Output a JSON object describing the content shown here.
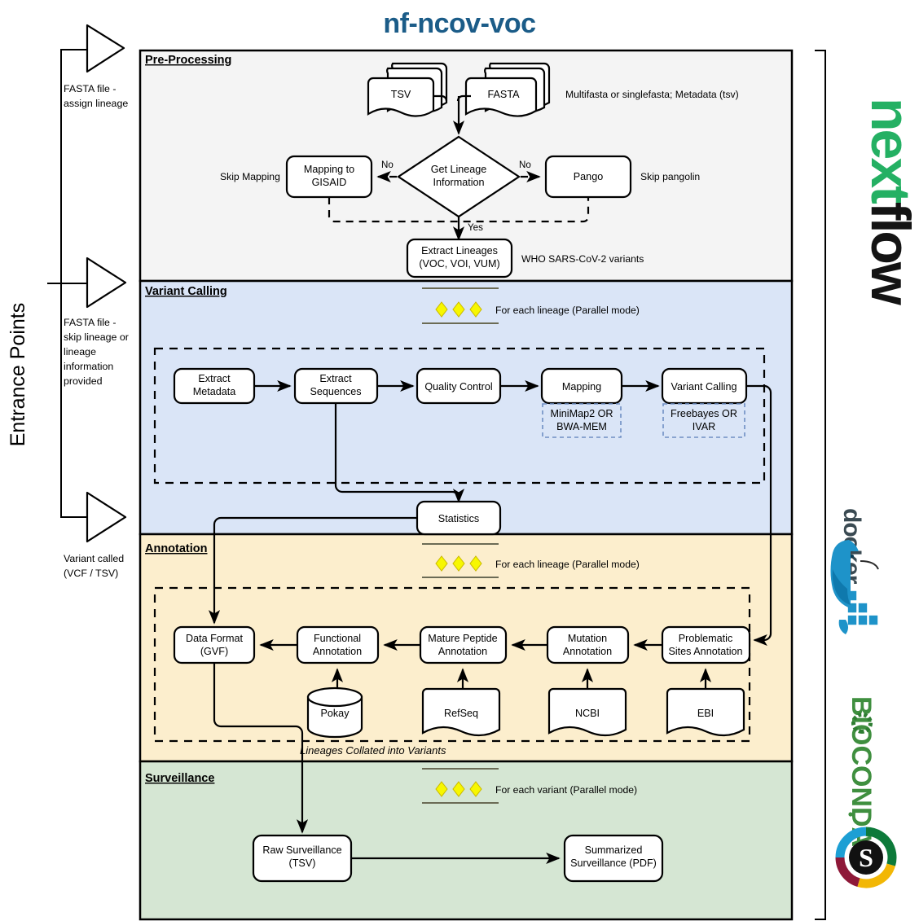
{
  "title": "nf-ncov-voc",
  "colors": {
    "title": "#1b5c88",
    "preprocessing_bg": "#f4f4f4",
    "variant_calling_bg": "#dae5f7",
    "annotation_bg": "#fceecd",
    "surveillance_bg": "#d5e6d3",
    "parallel_diamond": "#f7f700",
    "nextflow_green": "#22b06a",
    "docker_blue": "#2496ed",
    "bioconda_green": "#3f8f3f"
  },
  "entrance": {
    "axis_label": "Entrance Points",
    "points": [
      {
        "label": "FASTA file -\nassign lineage",
        "line1": "FASTA file -",
        "line2": "assign lineage"
      },
      {
        "label": "FASTA file - skip lineage or lineage information provided",
        "line1": "FASTA file -",
        "line2": "skip lineage or",
        "line3": "lineage",
        "line4": "information",
        "line5": "provided"
      },
      {
        "label": "Variant called (VCF / TSV)",
        "line1": "Variant called",
        "line2": "(VCF / TSV)"
      }
    ]
  },
  "sections": [
    {
      "id": "pre-processing",
      "title": "Pre-Processing",
      "nodes": [
        {
          "name": "tsv-document",
          "label": "TSV",
          "shape": "multi-document"
        },
        {
          "name": "fasta-document",
          "label": "FASTA",
          "shape": "multi-document"
        },
        {
          "name": "get-lineage-information",
          "label": "Get Lineage\nInformation",
          "line1": "Get Lineage",
          "line2": "Information",
          "shape": "diamond"
        },
        {
          "name": "mapping-to-gisaid",
          "label": "Mapping to\nGISAID",
          "line1": "Mapping to",
          "line2": "GISAID",
          "shape": "rounded-box"
        },
        {
          "name": "pango",
          "label": "Pango",
          "shape": "rounded-box"
        },
        {
          "name": "extract-lineages",
          "label": "Extract Lineages\n(VOC, VOI, VUM)",
          "line1": "Extract Lineages",
          "line2": "(VOC, VOI, VUM)",
          "shape": "rounded-box"
        }
      ],
      "annotations": [
        {
          "name": "input-note",
          "text": "Multifasta or singlefasta; Metadata (tsv)"
        },
        {
          "name": "skip-mapping-note",
          "text": "Skip Mapping"
        },
        {
          "name": "skip-pangolin-note",
          "text": "Skip pangolin"
        },
        {
          "name": "who-variants-note",
          "text": "WHO SARS-CoV-2 variants"
        }
      ],
      "edge_labels": [
        {
          "name": "edge-label-no-left",
          "text": "No"
        },
        {
          "name": "edge-label-no-right",
          "text": "No"
        },
        {
          "name": "edge-label-yes",
          "text": "Yes"
        }
      ]
    },
    {
      "id": "variant-calling",
      "title": "Variant Calling",
      "parallel_note": "For each lineage (Parallel mode)",
      "nodes": [
        {
          "name": "extract-metadata",
          "label": "Extract\nMetadata",
          "line1": "Extract",
          "line2": "Metadata"
        },
        {
          "name": "extract-sequences",
          "label": "Extract\nSequences",
          "line1": "Extract",
          "line2": "Sequences"
        },
        {
          "name": "quality-control",
          "label": "Quality Control",
          "line1": "Quality Control"
        },
        {
          "name": "mapping",
          "label": "Mapping",
          "line1": "Mapping"
        },
        {
          "name": "variant-calling-step",
          "label": "Variant Calling",
          "line1": "Variant Calling"
        },
        {
          "name": "statistics",
          "label": "Statistics",
          "line1": "Statistics"
        }
      ],
      "tool_notes": [
        {
          "name": "mapping-tools",
          "line1": "MiniMap2 OR",
          "line2": "BWA-MEM"
        },
        {
          "name": "variant-calling-tools",
          "line1": "Freebayes OR",
          "line2": "IVAR"
        }
      ]
    },
    {
      "id": "annotation",
      "title": "Annotation",
      "parallel_note": "For each lineage (Parallel mode)",
      "footer_note": "Lineages Collated into Variants",
      "nodes": [
        {
          "name": "data-format-gvf",
          "label": "Data Format\n(GVF)",
          "line1": "Data Format",
          "line2": "(GVF)"
        },
        {
          "name": "functional-annotation",
          "label": "Functional\nAnnotation",
          "line1": "Functional",
          "line2": "Annotation"
        },
        {
          "name": "mature-peptide-annotation",
          "label": "Mature Peptide\nAnnotation",
          "line1": "Mature Peptide",
          "line2": "Annotation"
        },
        {
          "name": "mutation-annotation",
          "label": "Mutation\nAnnotation",
          "line1": "Mutation",
          "line2": "Annotation"
        },
        {
          "name": "problematic-sites-annotation",
          "label": "Problematic\nSites Annotation",
          "line1": "Problematic",
          "line2": "Sites Annotation"
        }
      ],
      "sources": [
        {
          "name": "pokay-database",
          "label": "Pokay",
          "shape": "cylinder"
        },
        {
          "name": "refseq-document",
          "label": "RefSeq",
          "shape": "document"
        },
        {
          "name": "ncbi-document",
          "label": "NCBI",
          "shape": "document"
        },
        {
          "name": "ebi-document",
          "label": "EBI",
          "shape": "document"
        }
      ]
    },
    {
      "id": "surveillance",
      "title": "Surveillance",
      "parallel_note": "For each variant (Parallel mode)",
      "nodes": [
        {
          "name": "raw-surveillance",
          "label": "Raw Surveillance\n(TSV)",
          "line1": "Raw Surveillance",
          "line2": "(TSV)"
        },
        {
          "name": "summarized-surveillance",
          "label": "Summarized\nSurveillance (PDF)",
          "line1": "Summarized",
          "line2": "Surveillance (PDF)"
        }
      ]
    }
  ],
  "logos": [
    {
      "name": "nextflow-logo",
      "text_green": "next",
      "text_dark": "flow",
      "full": "nextflow"
    },
    {
      "name": "docker-logo",
      "text": "docker"
    },
    {
      "name": "bioconda-logo",
      "text": "BIOCONDA"
    },
    {
      "name": "singularity-logo",
      "text": "S"
    }
  ]
}
